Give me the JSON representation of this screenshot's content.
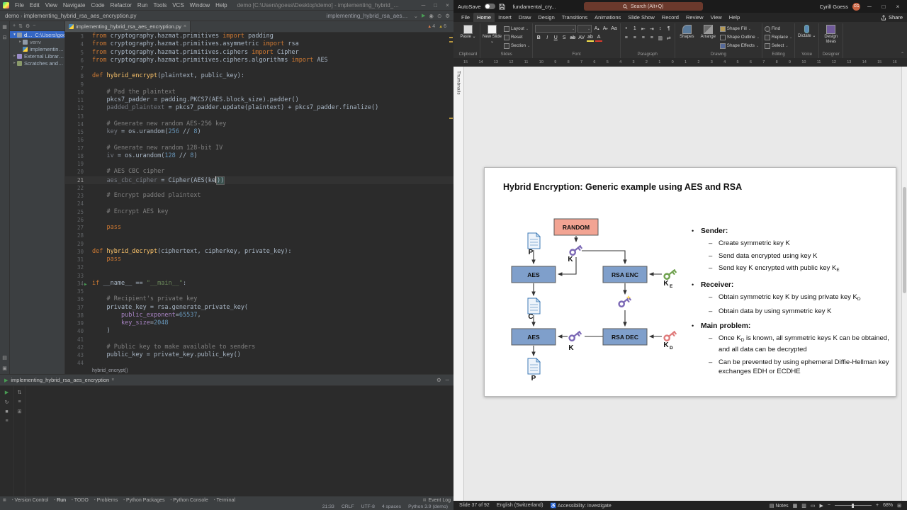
{
  "pycharm": {
    "title": "demo [C:\\Users\\goess\\Desktop\\demo] - implementing_hybrid_rsa_aes_encryption.py",
    "menu": [
      "File",
      "Edit",
      "View",
      "Navigate",
      "Code",
      "Refactor",
      "Run",
      "Tools",
      "VCS",
      "Window",
      "Help"
    ],
    "navbar": {
      "crumbs": [
        "demo",
        "implementing_hybrid_rsa_aes_encryption.py"
      ],
      "run_config": "implementing_hybrid_rsa_aes_encryption"
    },
    "project": {
      "rows": [
        {
          "label": "demo",
          "path": "C:\\Users\\goess\\De",
          "icon": "folder",
          "indent": 0,
          "selected": true,
          "chevron": "▾"
        },
        {
          "label": "venv",
          "icon": "folder",
          "indent": 1,
          "dim": true,
          "chevron": "▸"
        },
        {
          "label": "implementing_hybrid_rsa_aes_encryption.py",
          "icon": "python",
          "indent": 1,
          "chevron": " "
        },
        {
          "label": "External Libraries",
          "icon": "lib",
          "indent": 0,
          "chevron": "▸"
        },
        {
          "label": "Scratches and Consoles",
          "icon": "scratch",
          "indent": 0,
          "chevron": "▸"
        }
      ]
    },
    "tab": "implementing_hybrid_rsa_aes_encryption.py",
    "inspections": [
      {
        "count": "4"
      },
      {
        "count": "6"
      }
    ],
    "editor_lines": [
      {
        "n": 3,
        "s": [
          [
            "k",
            "from"
          ],
          [
            "t",
            " cryptography.hazmat.primitives "
          ],
          [
            "k",
            "import"
          ],
          [
            "t",
            " padding"
          ]
        ]
      },
      {
        "n": 4,
        "s": [
          [
            "k",
            "from"
          ],
          [
            "t",
            " cryptography.hazmat.primitives.asymmetric "
          ],
          [
            "k",
            "import"
          ],
          [
            "t",
            " rsa"
          ]
        ]
      },
      {
        "n": 5,
        "s": [
          [
            "k",
            "from"
          ],
          [
            "t",
            " cryptography.hazmat.primitives.ciphers "
          ],
          [
            "k",
            "import"
          ],
          [
            "t",
            " Cipher"
          ]
        ]
      },
      {
        "n": 6,
        "s": [
          [
            "k",
            "from"
          ],
          [
            "t",
            " cryptography.hazmat.primitives.ciphers.algorithms "
          ],
          [
            "k",
            "import"
          ],
          [
            "t",
            " AES"
          ]
        ]
      },
      {
        "n": 7,
        "s": []
      },
      {
        "n": 8,
        "s": [
          [
            "k",
            "def "
          ],
          [
            "f",
            "hybrid_encrypt"
          ],
          [
            "t",
            "("
          ],
          [
            "p",
            "plaintext"
          ],
          [
            "t",
            ", "
          ],
          [
            "p",
            "public_key"
          ],
          [
            "t",
            "):"
          ]
        ]
      },
      {
        "n": 9,
        "s": []
      },
      {
        "n": 10,
        "s": [
          [
            "c",
            "    # Pad the plaintext"
          ]
        ]
      },
      {
        "n": 11,
        "s": [
          [
            "t",
            "    pkcs7_padder = padding.PKCS7(AES.block_size).padder()"
          ]
        ]
      },
      {
        "n": 12,
        "s": [
          [
            "g",
            "    padded_plaintext"
          ],
          [
            "t",
            " = pkcs7_padder.update(plaintext) + pkcs7_padder.finalize()"
          ]
        ]
      },
      {
        "n": 13,
        "s": []
      },
      {
        "n": 14,
        "s": [
          [
            "c",
            "    # Generate new random AES-256 key"
          ]
        ]
      },
      {
        "n": 15,
        "s": [
          [
            "g",
            "    key"
          ],
          [
            "t",
            " = os.urandom("
          ],
          [
            "m",
            "256"
          ],
          [
            "t",
            " // "
          ],
          [
            "m",
            "8"
          ],
          [
            "t",
            ")"
          ]
        ]
      },
      {
        "n": 16,
        "s": []
      },
      {
        "n": 17,
        "s": [
          [
            "c",
            "    # Generate new random 128-bit IV"
          ]
        ]
      },
      {
        "n": 18,
        "s": [
          [
            "g",
            "    iv"
          ],
          [
            "t",
            " = os.urandom("
          ],
          [
            "m",
            "128"
          ],
          [
            "t",
            " // "
          ],
          [
            "m",
            "8"
          ],
          [
            "t",
            ")"
          ]
        ]
      },
      {
        "n": 19,
        "s": []
      },
      {
        "n": 20,
        "s": [
          [
            "c",
            "    # AES CBC cipher"
          ]
        ]
      },
      {
        "n": 21,
        "cur": true,
        "s": [
          [
            "g",
            "    aes_cbc_cipher"
          ],
          [
            "t",
            " = Cipher(AES(ke"
          ],
          [
            "crt",
            ""
          ],
          [
            "b",
            "))"
          ]
        ]
      },
      {
        "n": 22,
        "s": []
      },
      {
        "n": 23,
        "s": [
          [
            "c",
            "    # Encrypt padded plaintext"
          ]
        ]
      },
      {
        "n": 24,
        "s": []
      },
      {
        "n": 25,
        "s": [
          [
            "c",
            "    # Encrypt AES key"
          ]
        ]
      },
      {
        "n": 26,
        "s": []
      },
      {
        "n": 27,
        "s": [
          [
            "t",
            "    "
          ],
          [
            "k",
            "pass"
          ]
        ]
      },
      {
        "n": 28,
        "s": []
      },
      {
        "n": 29,
        "s": []
      },
      {
        "n": 30,
        "s": [
          [
            "k",
            "def "
          ],
          [
            "f",
            "hybrid_decrypt"
          ],
          [
            "t",
            "("
          ],
          [
            "p",
            "ciphertext"
          ],
          [
            "t",
            ", "
          ],
          [
            "p",
            "cipherkey"
          ],
          [
            "t",
            ", "
          ],
          [
            "p",
            "private_key"
          ],
          [
            "t",
            "):"
          ]
        ]
      },
      {
        "n": 31,
        "s": [
          [
            "t",
            "    "
          ],
          [
            "k",
            "pass"
          ]
        ]
      },
      {
        "n": 32,
        "s": []
      },
      {
        "n": 33,
        "s": []
      },
      {
        "n": 34,
        "run": true,
        "s": [
          [
            "k",
            "if"
          ],
          [
            "t",
            " __name__ == "
          ],
          [
            "st",
            "\"__main__\""
          ],
          [
            "t",
            ":"
          ]
        ]
      },
      {
        "n": 35,
        "s": []
      },
      {
        "n": 36,
        "s": [
          [
            "c",
            "    # Recipient's private key"
          ]
        ]
      },
      {
        "n": 37,
        "s": [
          [
            "t",
            "    private_key = rsa.generate_private_key("
          ]
        ]
      },
      {
        "n": 38,
        "s": [
          [
            "t",
            "        "
          ],
          [
            "a",
            "public_exponent"
          ],
          [
            "t",
            "="
          ],
          [
            "m",
            "65537"
          ],
          [
            "t",
            ","
          ]
        ]
      },
      {
        "n": 39,
        "s": [
          [
            "t",
            "        "
          ],
          [
            "a",
            "key_size"
          ],
          [
            "t",
            "="
          ],
          [
            "m",
            "2048"
          ]
        ]
      },
      {
        "n": 40,
        "s": [
          [
            "t",
            "    )"
          ]
        ]
      },
      {
        "n": 41,
        "s": []
      },
      {
        "n": 42,
        "s": [
          [
            "c",
            "    # Public key to make available to senders"
          ]
        ]
      },
      {
        "n": 43,
        "s": [
          [
            "t",
            "    public_key = private_key.public_key()"
          ]
        ]
      },
      {
        "n": 44,
        "s": []
      }
    ],
    "breadcrumb": "hybrid_encrypt()",
    "run_panel": {
      "tab": "implementing_hybrid_rsa_aes_encryption"
    },
    "toolwindows": [
      "Version Control",
      "Run",
      "TODO",
      "Problems",
      "Python Packages",
      "Python Console",
      "Terminal"
    ],
    "event_log": "Event Log",
    "status": [
      "21:33",
      "CRLF",
      "UTF-8",
      "4 spaces",
      "Python 3.9 (demo)"
    ],
    "accent_green": "#499C54",
    "selection_blue": "#3567c4"
  },
  "powerpoint": {
    "titlebar": {
      "autosave": "AutoSave",
      "filename": "fundamental_cry...",
      "search": "Search (Alt+Q)",
      "user": "Cyrill Goess",
      "user_initials": "CG"
    },
    "tabs": [
      "File",
      "Home",
      "Insert",
      "Draw",
      "Design",
      "Transitions",
      "Animations",
      "Slide Show",
      "Record",
      "Review",
      "View",
      "Help"
    ],
    "active_tab": "Home",
    "share": "Share",
    "ribbon_groups": [
      {
        "label": "Clipboard",
        "big": [
          {
            "name": "paste",
            "text": "Paste",
            "arrow": true
          }
        ]
      },
      {
        "label": "Slides",
        "big": [
          {
            "name": "new-slide",
            "text": "New Slide",
            "arrow": true
          }
        ],
        "small": [
          {
            "name": "layout",
            "text": "Layout",
            "arrow": true
          },
          {
            "name": "reset",
            "text": "Reset"
          },
          {
            "name": "section",
            "text": "Section",
            "arrow": true
          }
        ]
      },
      {
        "label": "Font",
        "font": true
      },
      {
        "label": "Paragraph",
        "para": true
      },
      {
        "label": "Drawing",
        "big": [
          {
            "name": "shapes",
            "text": "Shapes"
          },
          {
            "name": "arrange",
            "text": "Arrange"
          }
        ],
        "small": [
          {
            "name": "shape-fill",
            "text": "Shape Fill",
            "arrow": true
          },
          {
            "name": "shape-outline",
            "text": "Shape Outline",
            "arrow": true
          },
          {
            "name": "shape-effects",
            "text": "Shape Effects",
            "arrow": true
          }
        ]
      },
      {
        "label": "Editing",
        "small": [
          {
            "name": "find",
            "text": "Find"
          },
          {
            "name": "replace",
            "text": "Replace",
            "arrow": true
          },
          {
            "name": "select",
            "text": "Select",
            "arrow": true
          }
        ]
      },
      {
        "label": "Voice",
        "big": [
          {
            "name": "dictate",
            "text": "Dictate",
            "arrow": true
          }
        ]
      },
      {
        "label": "Designer",
        "big": [
          {
            "name": "design-ideas",
            "text": "Design Ideas"
          }
        ]
      }
    ],
    "thumbnails_label": "Thumbnails",
    "ruler": [
      "15",
      "14",
      "13",
      "12",
      "11",
      "10",
      "9",
      "8",
      "7",
      "6",
      "5",
      "4",
      "3",
      "2",
      "1",
      "0",
      "1",
      "2",
      "3",
      "4",
      "5",
      "6",
      "7",
      "8",
      "9",
      "10",
      "11",
      "12",
      "13",
      "14",
      "15",
      "16"
    ],
    "slide": {
      "title": "Hybrid Encryption: Generic example using AES and RSA",
      "diagram": {
        "random": "RANDOM",
        "aes1": "AES",
        "rsa_enc": "RSA ENC",
        "aes2": "AES",
        "rsa_dec": "RSA DEC",
        "p1": "P",
        "k1": "K",
        "c": "C",
        "k2": "K",
        "ke": "K",
        "ke_sub": "E",
        "kd": "K",
        "kd_sub": "D",
        "p2": "P",
        "colors": {
          "random_box": "#F2A493",
          "cipher_box": "#7F9FCB",
          "key_purple": "#7B68B5",
          "key_green": "#6FA14E",
          "key_pink": "#E07B7B"
        }
      },
      "bullets": [
        {
          "level": 1,
          "pre": "Sender:"
        },
        {
          "level": 2,
          "pre": "Create symmetric key K"
        },
        {
          "level": 2,
          "pre": "Send data encrypted using key K"
        },
        {
          "level": 2,
          "pre": "Send key K encrypted with public key K",
          "sub": "E"
        },
        {
          "level": 1,
          "pre": "Receiver:"
        },
        {
          "level": 2,
          "pre": "Obtain symmetric key K by using private key K",
          "sub": "D"
        },
        {
          "level": 2,
          "pre": "Obtain data by using symmetric key K"
        },
        {
          "level": 1,
          "pre": "Main problem:"
        },
        {
          "level": 2,
          "pre": "Once K",
          "sub": "D",
          "post": " is known, all symmetric keys K can be obtained, and all data can be decrypted"
        },
        {
          "level": 2,
          "pre": "Can be prevented by using ephemeral Diffie-Hellman key exchanges EDH or ECDHE"
        }
      ]
    },
    "statusbar": {
      "slide_info": "Slide 37 of 92",
      "language": "English (Switzerland)",
      "accessibility": "Accessibility: Investigate",
      "notes": "Notes",
      "zoom": "68%"
    }
  }
}
